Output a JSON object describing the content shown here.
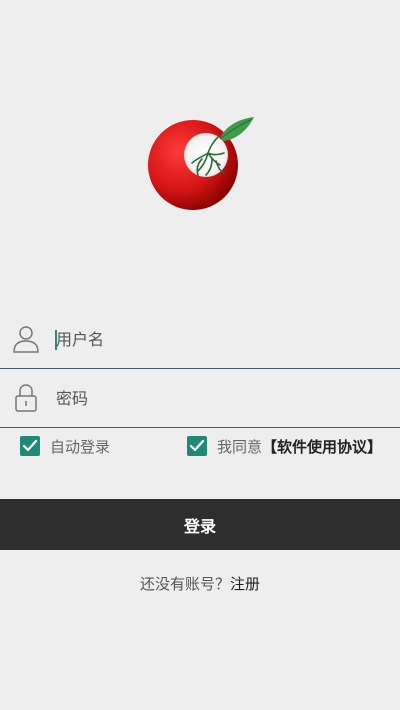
{
  "logo": {
    "icon": "apple-sprout-logo",
    "colors": {
      "red": "#d61515",
      "dark_red": "#8a0000",
      "leaf": "#3f9a4a",
      "root": "#2f6a3a"
    }
  },
  "form": {
    "username": {
      "placeholder": "用户名",
      "value": "",
      "icon": "user-icon"
    },
    "password": {
      "placeholder": "密码",
      "value": "",
      "icon": "lock-icon"
    }
  },
  "options": {
    "auto_login": {
      "label": "自动登录",
      "checked": true
    },
    "agree": {
      "label": "我同意",
      "link": "【软件使用协议】",
      "checked": true
    }
  },
  "login_button": {
    "label": "登录"
  },
  "register": {
    "prompt": "还没有账号？",
    "link": "注册"
  },
  "colors": {
    "background": "#eeeeee",
    "accent": "#1f8a78",
    "button_bg": "#2e2e2e",
    "divider": "#4a5a7a"
  }
}
